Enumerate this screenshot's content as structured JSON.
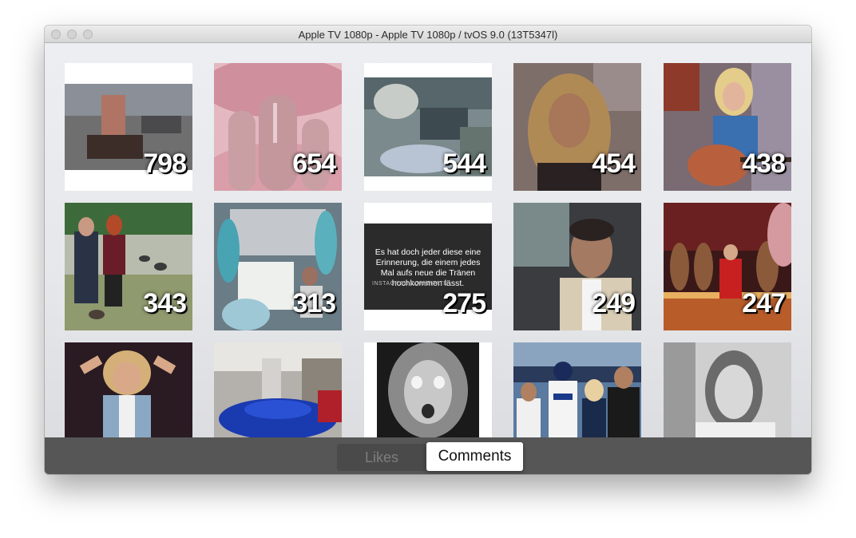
{
  "window": {
    "title": "Apple TV 1080p - Apple TV 1080p / tvOS 9.0 (13T5347l)"
  },
  "grid": {
    "tiles": [
      {
        "count": "798"
      },
      {
        "count": "654"
      },
      {
        "count": "544"
      },
      {
        "count": "454"
      },
      {
        "count": "438"
      },
      {
        "count": "343"
      },
      {
        "count": "313"
      },
      {
        "count": "275",
        "quote": "Es hat doch jeder diese eine Erinnerung, die einem jedes Mal aufs neue die Tränen hochkommen lässt.",
        "quote_source": "INSTAGRAM.COM/ZITATE"
      },
      {
        "count": "249"
      },
      {
        "count": "247"
      },
      {
        "count": ""
      },
      {
        "count": ""
      },
      {
        "count": ""
      },
      {
        "count": ""
      },
      {
        "count": ""
      }
    ]
  },
  "tabs": {
    "likes": "Likes",
    "comments": "Comments",
    "selected": "comments"
  }
}
